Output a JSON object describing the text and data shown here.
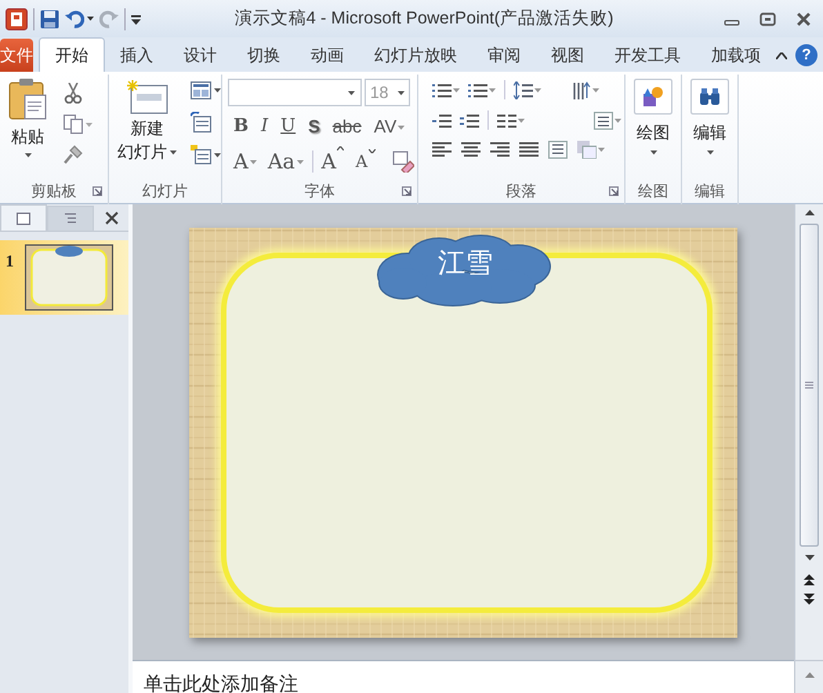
{
  "window": {
    "title": "演示文稿4  -  Microsoft PowerPoint(产品激活失败)",
    "help": "?"
  },
  "tabs": [
    {
      "label": "文件",
      "kind": "file",
      "selected": false
    },
    {
      "label": "开始",
      "kind": "tab",
      "selected": true
    },
    {
      "label": "插入",
      "kind": "tab",
      "selected": false
    },
    {
      "label": "设计",
      "kind": "tab",
      "selected": false
    },
    {
      "label": "切换",
      "kind": "tab",
      "selected": false
    },
    {
      "label": "动画",
      "kind": "tab",
      "selected": false
    },
    {
      "label": "幻灯片放映",
      "kind": "tab",
      "selected": false
    },
    {
      "label": "审阅",
      "kind": "tab",
      "selected": false
    },
    {
      "label": "视图",
      "kind": "tab",
      "selected": false
    },
    {
      "label": "开发工具",
      "kind": "tab",
      "selected": false
    },
    {
      "label": "加载项",
      "kind": "tab",
      "selected": false
    }
  ],
  "ribbon": {
    "clipboard": {
      "paste": "粘贴",
      "label": "剪贴板"
    },
    "slides": {
      "new_slide": [
        "新建",
        "幻灯片"
      ],
      "label": "幻灯片"
    },
    "font": {
      "size": "18",
      "format_buttons": [
        "B",
        "I",
        "U",
        "S",
        "abc",
        "AV"
      ],
      "size_buttons": [
        "A",
        "Aa",
        "A",
        "A"
      ],
      "label": "字体"
    },
    "paragraph": {
      "label": "段落"
    },
    "drawing": {
      "button": "绘图",
      "label": "绘图"
    },
    "editing": {
      "button": "编辑",
      "label": "编辑"
    }
  },
  "slide_panel": {
    "slides": [
      {
        "number": "1",
        "selected": true
      }
    ]
  },
  "slide": {
    "shape_text": "江雪"
  },
  "notes": {
    "placeholder": "单击此处添加备注"
  }
}
